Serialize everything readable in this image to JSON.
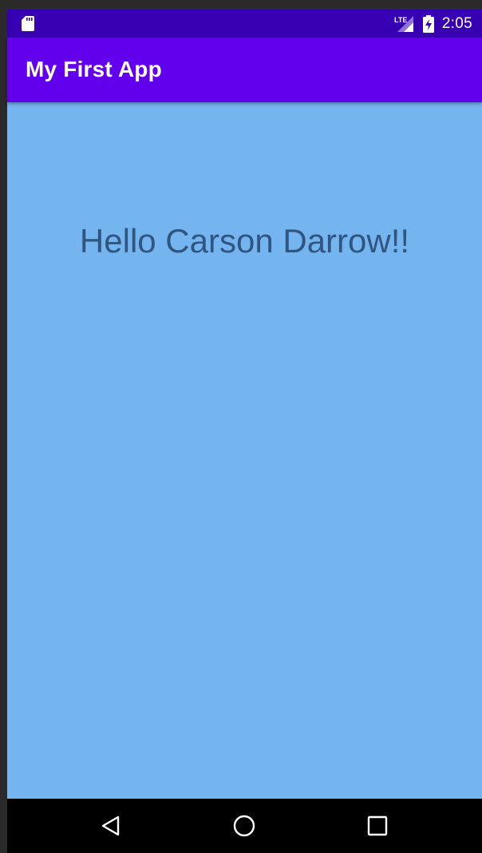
{
  "status_bar": {
    "time": "2:05",
    "network_label": "LTE",
    "left_icon": "sd-card-icon",
    "background": "#3700b3"
  },
  "app_bar": {
    "title": "My First App",
    "background": "#6200ee"
  },
  "content": {
    "greeting": "Hello Carson Darrow!!",
    "background": "#74b5f0",
    "text_color": "#2f5580"
  },
  "nav_bar": {
    "buttons": [
      "back-icon",
      "home-icon",
      "recents-icon"
    ]
  }
}
